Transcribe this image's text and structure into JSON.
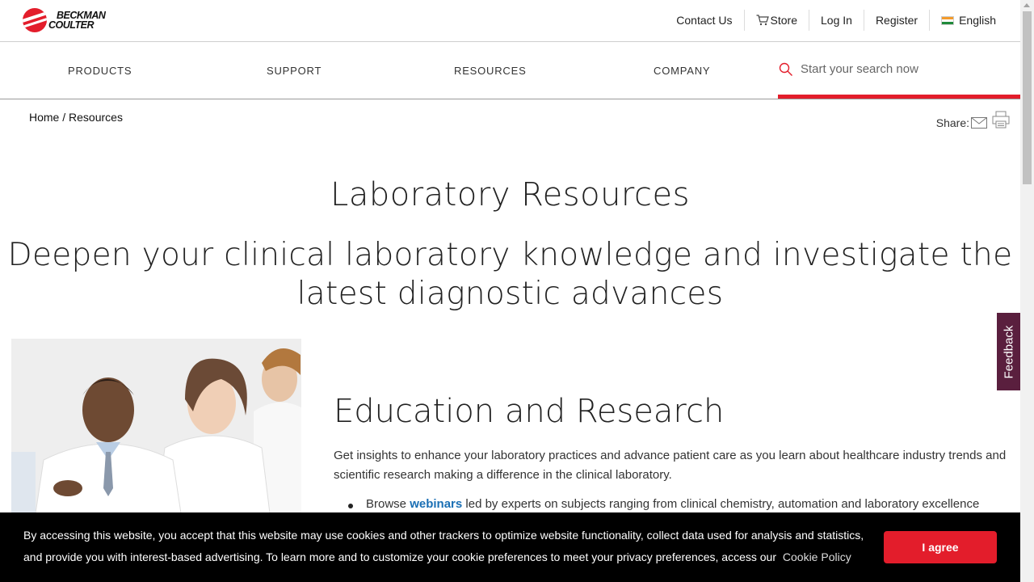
{
  "brand": {
    "line1": "BECKMAN",
    "line2": "COULTER",
    "accent_color": "#e31d2b"
  },
  "utility_nav": {
    "contact": "Contact Us",
    "store": "Store",
    "login": "Log In",
    "register": "Register",
    "language": "English"
  },
  "main_nav": {
    "products": "PRODUCTS",
    "support": "SUPPORT",
    "resources": "RESOURCES",
    "company": "COMPANY"
  },
  "search": {
    "placeholder": "Start your search now"
  },
  "breadcrumb": {
    "home": "Home",
    "separator": "/",
    "current": "Resources"
  },
  "share": {
    "label": "Share:"
  },
  "page": {
    "title": "Laboratory Resources",
    "subtitle": "Deepen your clinical laboratory knowledge and investigate the latest diagnostic advances"
  },
  "section": {
    "title": "Education and Research",
    "intro": "Get insights to enhance your laboratory practices and advance patient care as you learn about healthcare industry trends and scientific research making a difference in the clinical laboratory.",
    "bullet_prefix": "Browse",
    "bullet_link": "webinars",
    "bullet_suffix": "led by experts on subjects ranging from clinical chemistry, automation and laboratory excellence"
  },
  "feedback": {
    "label": "Feedback"
  },
  "cookie": {
    "text": "By accessing this website, you accept that this website may use cookies and other trackers to optimize website functionality, collect data used for analysis and statistics, and provide you with interest-based advertising. To learn more and to customize your cookie preferences to meet your privacy preferences, access our",
    "link": "Cookie Policy",
    "button": "I agree"
  }
}
